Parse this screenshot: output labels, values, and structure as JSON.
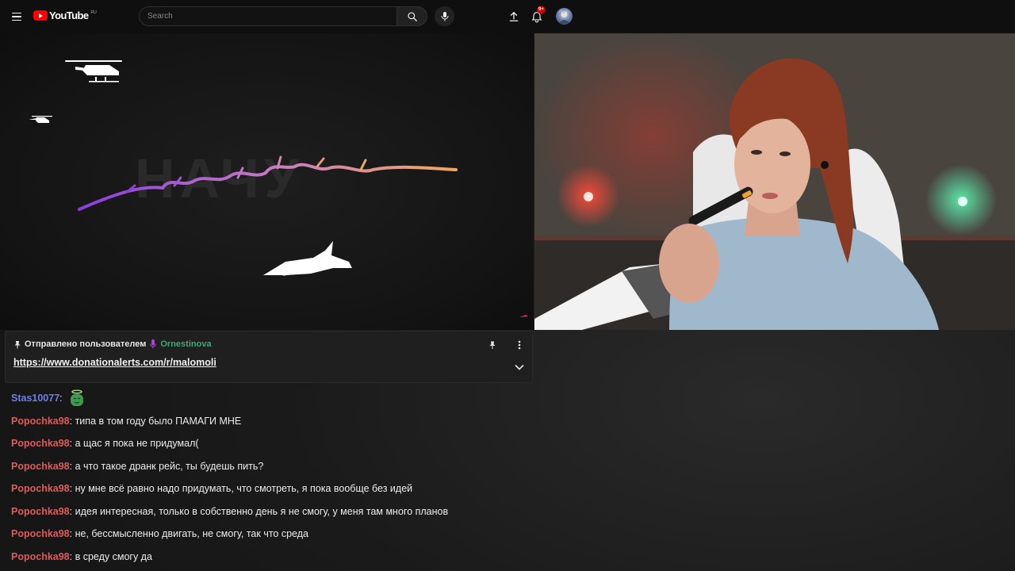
{
  "header": {
    "logo_text": "YouTube",
    "logo_region": "RU",
    "search_placeholder": "Search",
    "notification_count": "9+"
  },
  "video_left": {
    "watermark": "НАЧУ",
    "script_label": "начинс"
  },
  "pinned": {
    "sent_by_label": "Отправлено пользователем",
    "username": "Ornestinova",
    "link": "https://www.donationalerts.com/r/malomoli"
  },
  "chat": {
    "messages": [
      {
        "author": "Stas10077",
        "text": ""
      },
      {
        "author": "Popochka98",
        "text": ": типа в том году было ПАМАГИ МНЕ"
      },
      {
        "author": "Popochka98",
        "text": ": а щас я пока не придумал("
      },
      {
        "author": "Popochka98",
        "text": ": а что такое дранк рейс, ты будешь пить?"
      },
      {
        "author": "Popochka98",
        "text": ": ну мне всё равно надо придумать, что смотреть, я пока вообще без идей"
      },
      {
        "author": "Popochka98",
        "text": ": идея интересная, только в собственно день я не смогу, у меня там много планов"
      },
      {
        "author": "Popochka98",
        "text": ": не, бессмысленно двигать, не смогу, так что среда"
      },
      {
        "author": "Popochka98",
        "text": ": в среду смогу да"
      }
    ]
  },
  "colors": {
    "brand_red": "#ff0000",
    "author_blue": "#6f7fe6",
    "author_red": "#e05b5b",
    "pinned_user_green": "#3fa678"
  }
}
